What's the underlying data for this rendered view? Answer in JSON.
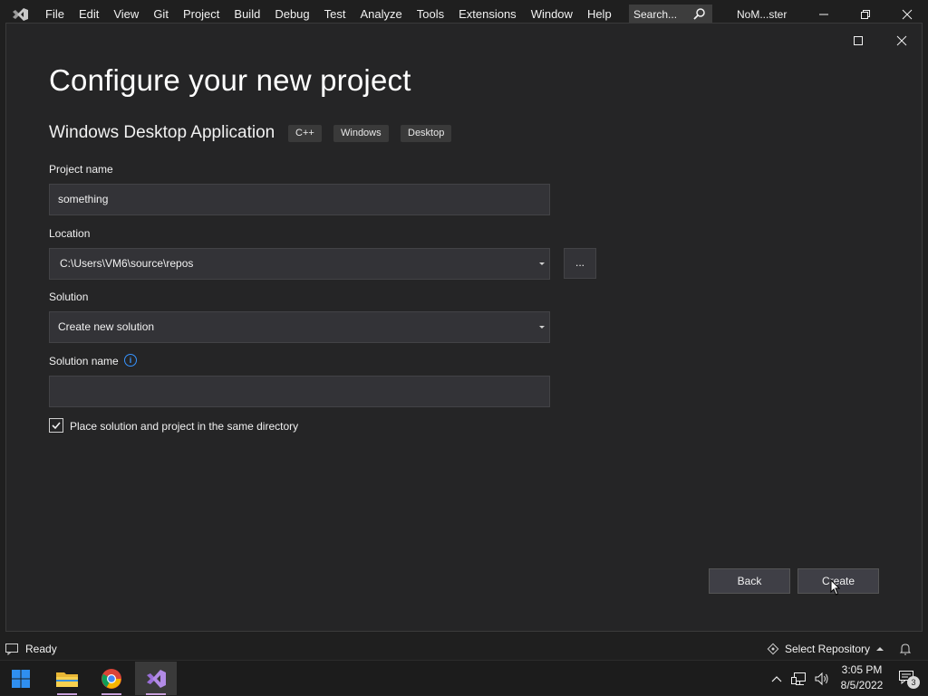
{
  "menubar": {
    "items": [
      "File",
      "Edit",
      "View",
      "Git",
      "Project",
      "Build",
      "Debug",
      "Test",
      "Analyze",
      "Tools",
      "Extensions",
      "Window",
      "Help"
    ],
    "search_placeholder": "Search...",
    "app_title": "NoM...ster"
  },
  "dialog": {
    "title": "Configure your new project",
    "template_name": "Windows Desktop Application",
    "tags": [
      "C++",
      "Windows",
      "Desktop"
    ],
    "project_name": {
      "label": "Project name",
      "value": "something"
    },
    "location": {
      "label": "Location",
      "value": "C:\\Users\\VM6\\source\\repos",
      "browse_label": "..."
    },
    "solution": {
      "label": "Solution",
      "value": "Create new solution"
    },
    "solution_name": {
      "label": "Solution name",
      "value": ""
    },
    "same_directory": {
      "label": "Place solution and project in the same directory",
      "checked": true
    },
    "back_label": "Back",
    "create_label": "Create"
  },
  "statusbar": {
    "status": "Ready",
    "repo_label": "Select Repository"
  },
  "taskbar": {
    "time": "3:05 PM",
    "date": "8/5/2022",
    "notification_count": "3"
  },
  "colors": {
    "accent": "#3794ff",
    "vs_purple": "#9b6fd9",
    "background": "#252526"
  }
}
